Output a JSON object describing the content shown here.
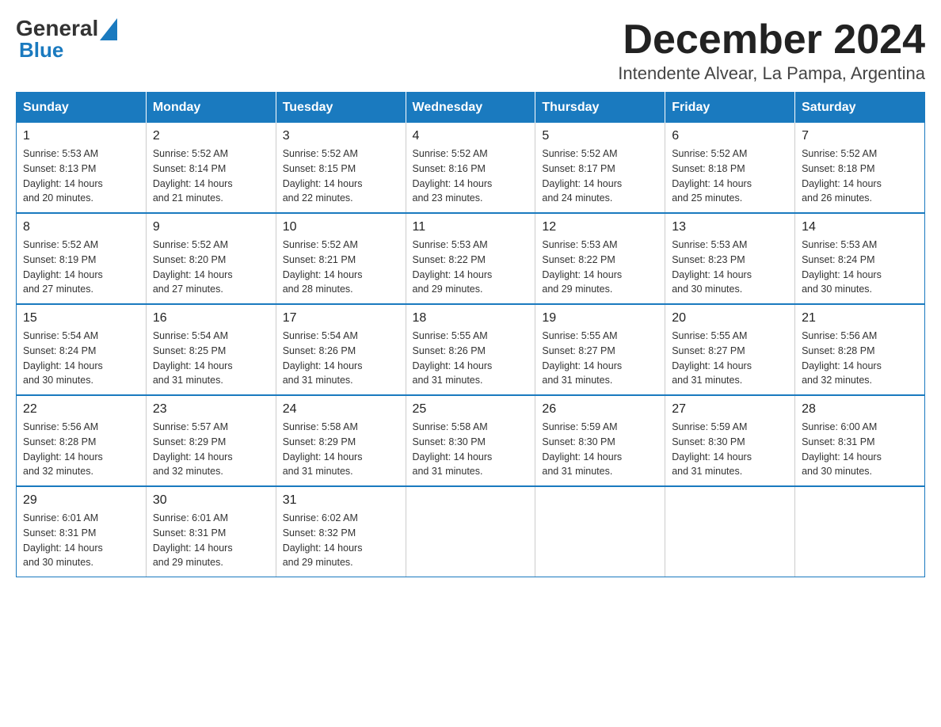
{
  "header": {
    "logo": {
      "general": "General",
      "blue": "Blue"
    },
    "title": "December 2024",
    "subtitle": "Intendente Alvear, La Pampa, Argentina"
  },
  "weekdays": [
    "Sunday",
    "Monday",
    "Tuesday",
    "Wednesday",
    "Thursday",
    "Friday",
    "Saturday"
  ],
  "weeks": [
    [
      {
        "day": 1,
        "sunrise": "5:53 AM",
        "sunset": "8:13 PM",
        "daylight": "14 hours and 20 minutes."
      },
      {
        "day": 2,
        "sunrise": "5:52 AM",
        "sunset": "8:14 PM",
        "daylight": "14 hours and 21 minutes."
      },
      {
        "day": 3,
        "sunrise": "5:52 AM",
        "sunset": "8:15 PM",
        "daylight": "14 hours and 22 minutes."
      },
      {
        "day": 4,
        "sunrise": "5:52 AM",
        "sunset": "8:16 PM",
        "daylight": "14 hours and 23 minutes."
      },
      {
        "day": 5,
        "sunrise": "5:52 AM",
        "sunset": "8:17 PM",
        "daylight": "14 hours and 24 minutes."
      },
      {
        "day": 6,
        "sunrise": "5:52 AM",
        "sunset": "8:18 PM",
        "daylight": "14 hours and 25 minutes."
      },
      {
        "day": 7,
        "sunrise": "5:52 AM",
        "sunset": "8:18 PM",
        "daylight": "14 hours and 26 minutes."
      }
    ],
    [
      {
        "day": 8,
        "sunrise": "5:52 AM",
        "sunset": "8:19 PM",
        "daylight": "14 hours and 27 minutes."
      },
      {
        "day": 9,
        "sunrise": "5:52 AM",
        "sunset": "8:20 PM",
        "daylight": "14 hours and 27 minutes."
      },
      {
        "day": 10,
        "sunrise": "5:52 AM",
        "sunset": "8:21 PM",
        "daylight": "14 hours and 28 minutes."
      },
      {
        "day": 11,
        "sunrise": "5:53 AM",
        "sunset": "8:22 PM",
        "daylight": "14 hours and 29 minutes."
      },
      {
        "day": 12,
        "sunrise": "5:53 AM",
        "sunset": "8:22 PM",
        "daylight": "14 hours and 29 minutes."
      },
      {
        "day": 13,
        "sunrise": "5:53 AM",
        "sunset": "8:23 PM",
        "daylight": "14 hours and 30 minutes."
      },
      {
        "day": 14,
        "sunrise": "5:53 AM",
        "sunset": "8:24 PM",
        "daylight": "14 hours and 30 minutes."
      }
    ],
    [
      {
        "day": 15,
        "sunrise": "5:54 AM",
        "sunset": "8:24 PM",
        "daylight": "14 hours and 30 minutes."
      },
      {
        "day": 16,
        "sunrise": "5:54 AM",
        "sunset": "8:25 PM",
        "daylight": "14 hours and 31 minutes."
      },
      {
        "day": 17,
        "sunrise": "5:54 AM",
        "sunset": "8:26 PM",
        "daylight": "14 hours and 31 minutes."
      },
      {
        "day": 18,
        "sunrise": "5:55 AM",
        "sunset": "8:26 PM",
        "daylight": "14 hours and 31 minutes."
      },
      {
        "day": 19,
        "sunrise": "5:55 AM",
        "sunset": "8:27 PM",
        "daylight": "14 hours and 31 minutes."
      },
      {
        "day": 20,
        "sunrise": "5:55 AM",
        "sunset": "8:27 PM",
        "daylight": "14 hours and 31 minutes."
      },
      {
        "day": 21,
        "sunrise": "5:56 AM",
        "sunset": "8:28 PM",
        "daylight": "14 hours and 32 minutes."
      }
    ],
    [
      {
        "day": 22,
        "sunrise": "5:56 AM",
        "sunset": "8:28 PM",
        "daylight": "14 hours and 32 minutes."
      },
      {
        "day": 23,
        "sunrise": "5:57 AM",
        "sunset": "8:29 PM",
        "daylight": "14 hours and 32 minutes."
      },
      {
        "day": 24,
        "sunrise": "5:58 AM",
        "sunset": "8:29 PM",
        "daylight": "14 hours and 31 minutes."
      },
      {
        "day": 25,
        "sunrise": "5:58 AM",
        "sunset": "8:30 PM",
        "daylight": "14 hours and 31 minutes."
      },
      {
        "day": 26,
        "sunrise": "5:59 AM",
        "sunset": "8:30 PM",
        "daylight": "14 hours and 31 minutes."
      },
      {
        "day": 27,
        "sunrise": "5:59 AM",
        "sunset": "8:30 PM",
        "daylight": "14 hours and 31 minutes."
      },
      {
        "day": 28,
        "sunrise": "6:00 AM",
        "sunset": "8:31 PM",
        "daylight": "14 hours and 30 minutes."
      }
    ],
    [
      {
        "day": 29,
        "sunrise": "6:01 AM",
        "sunset": "8:31 PM",
        "daylight": "14 hours and 30 minutes."
      },
      {
        "day": 30,
        "sunrise": "6:01 AM",
        "sunset": "8:31 PM",
        "daylight": "14 hours and 29 minutes."
      },
      {
        "day": 31,
        "sunrise": "6:02 AM",
        "sunset": "8:32 PM",
        "daylight": "14 hours and 29 minutes."
      },
      null,
      null,
      null,
      null
    ]
  ],
  "labels": {
    "sunrise": "Sunrise:",
    "sunset": "Sunset:",
    "daylight": "Daylight:"
  }
}
